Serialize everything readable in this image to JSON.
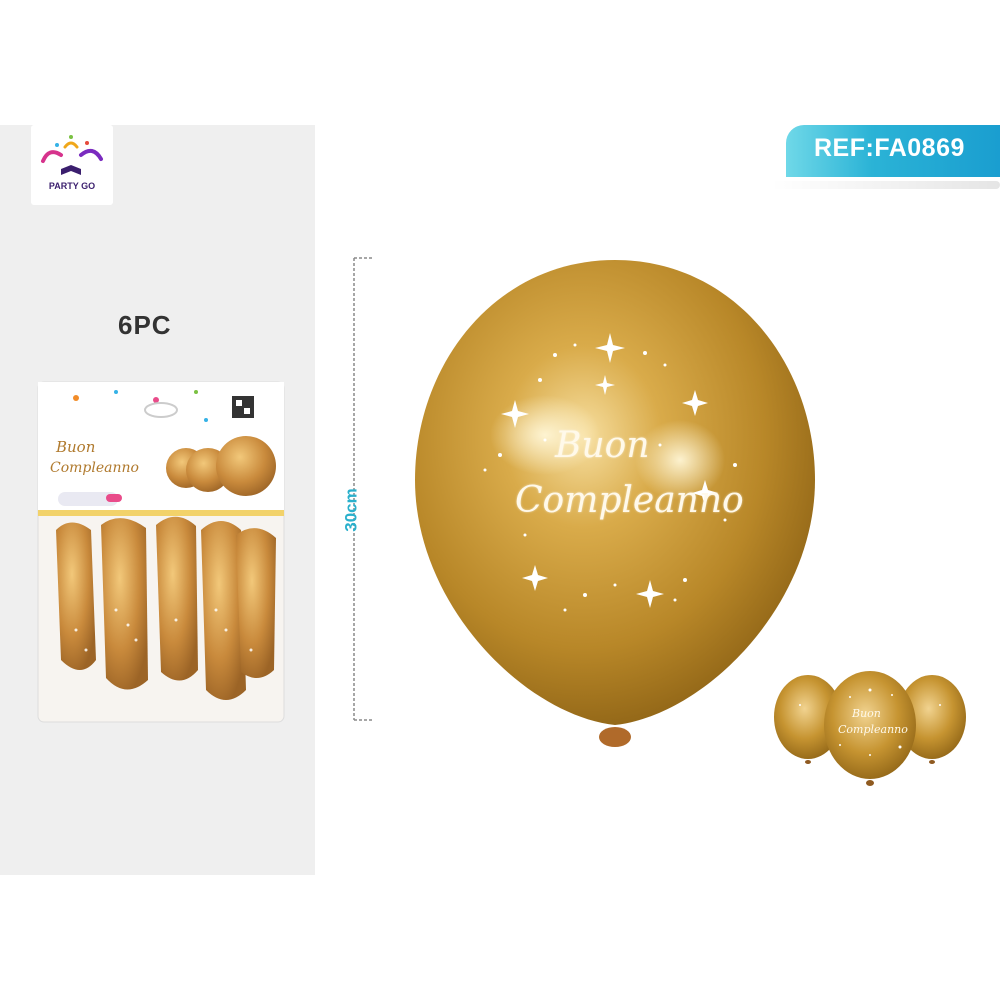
{
  "logo": {
    "brand": "PARTY GO"
  },
  "pack": {
    "quantity": "6PC",
    "print_line1": "Buon",
    "print_line2": "Compleanno"
  },
  "ref": {
    "label": "REF:FA0869"
  },
  "dimension": {
    "label": "30cm"
  },
  "balloon": {
    "line1": "Buon",
    "line2": "Compleanno",
    "color": "#c9982f"
  },
  "colors": {
    "accent": "#2ab0cc",
    "gold": "#c9982f"
  }
}
